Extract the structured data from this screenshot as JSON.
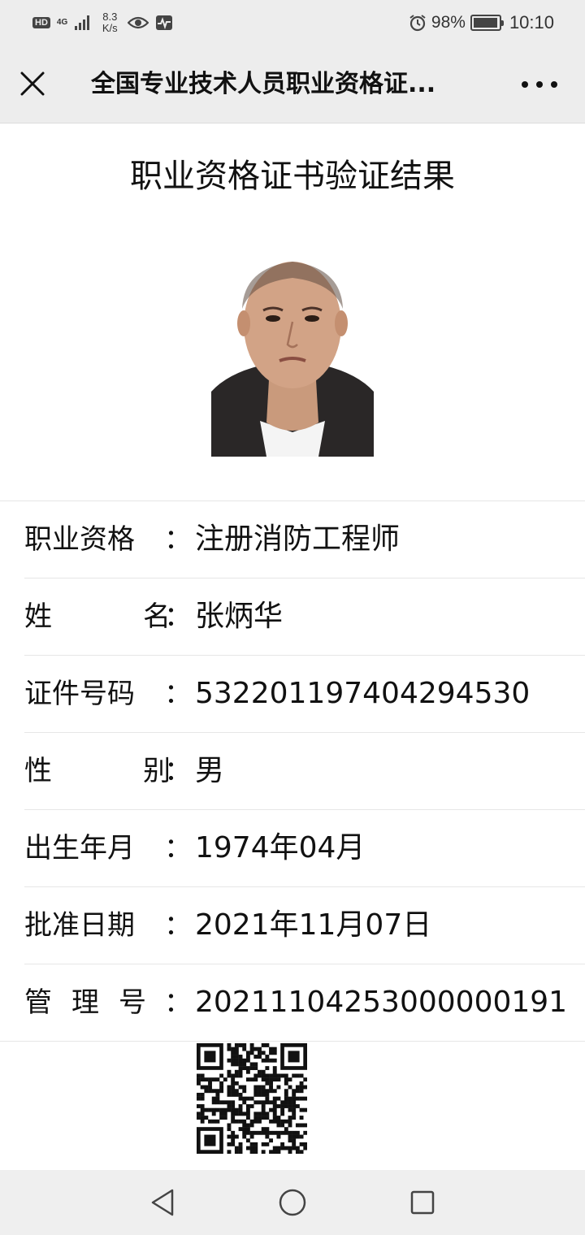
{
  "status_bar": {
    "hd": "HD",
    "network": "4G",
    "speed_value": "8.3",
    "speed_unit": "K/s",
    "battery_percent": "98%",
    "battery_level": 0.98,
    "time": "10:10",
    "icons": [
      "hd-icon",
      "signal-icon",
      "eye-icon",
      "activity-icon",
      "alarm-icon",
      "battery-icon"
    ]
  },
  "nav_bar": {
    "title": "全国专业技术人员职业资格证...",
    "icons": [
      "close-icon",
      "more-icon"
    ]
  },
  "page": {
    "heading": "职业资格证书验证结果"
  },
  "details": [
    {
      "label": "职业资格",
      "value": "注册消防工程师"
    },
    {
      "label": "姓名",
      "value": "张炳华"
    },
    {
      "label": "证件号码",
      "value": "532201197404294530"
    },
    {
      "label": "性别",
      "value": "男"
    },
    {
      "label": "出生年月",
      "value": "1974年04月"
    },
    {
      "label": "批准日期",
      "value": "2021年11月07日"
    },
    {
      "label": "管理号",
      "value": "20211104253000000191"
    }
  ],
  "colon": "：",
  "system_nav": {
    "icons": [
      "back-icon",
      "home-icon",
      "recents-icon"
    ]
  },
  "colors": {
    "bar_background": "#ededed",
    "text": "#111111",
    "divider": "#e6e6e6"
  }
}
